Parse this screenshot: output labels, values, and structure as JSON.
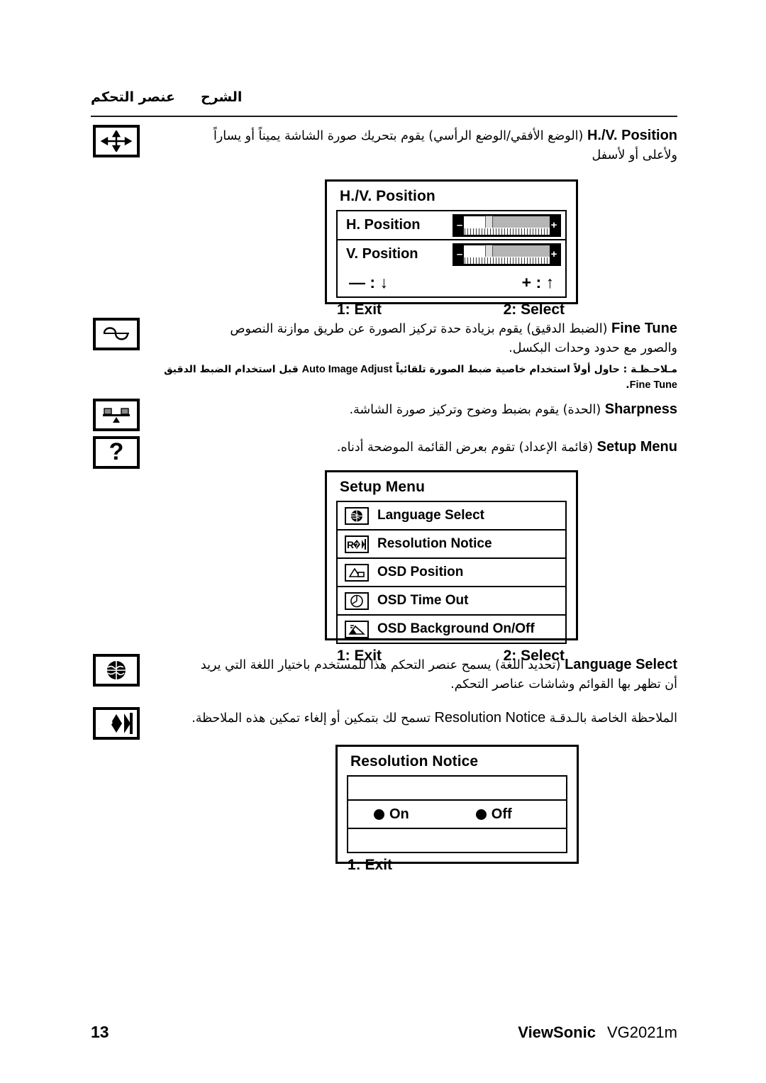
{
  "header": {
    "col_control": "عنصر التحكم",
    "col_explanation": "الشرح"
  },
  "rows": [
    {
      "icon": "four-way-arrow-icon",
      "term": "H./V. Position",
      "text_line1": "(الوضع الأفقي/الوضع الرأسي) يقوم بتحريك صورة الشاشة يميناً أو يساراً",
      "text_line2": "ولأعلى أو لأسفل"
    },
    {
      "icon": "sine-wave-icon",
      "term": "Fine Tune",
      "text_line1": "(الضبط الدقيق) يقوم بزيادة حدة تركيز الصورة عن طريق موازنة النصوص",
      "text_line2": "والصور مع حدود وحدات البكسل.",
      "note_prefix": "مـلاحـظـة : حاول أولاً استخدام خاصية ضبط الصورة تلقائياً",
      "note_term": "Auto Image Adjust",
      "note_middle": "قبل استخدام الضبط الدقيق",
      "note_term2": "Fine Tune",
      "note_suffix": "."
    },
    {
      "icon": "sharpness-balance-icon",
      "term": "Sharpness",
      "text_line1": "(الحدة) يقوم بضبط وضوح وتركيز صورة الشاشة."
    },
    {
      "icon": "question-mark-icon",
      "term": "Setup Menu",
      "text_line1": "(قائمة الإعداد) تقوم بعرض القائمة الموضحة أدناه."
    },
    {
      "icon": "globe-icon",
      "term": "Language Select",
      "text_line1": "(تحديد اللغة) يسمح عنصر التحكم هذا للمستخدم باختيار اللغة التي يريد",
      "text_line2": "أن تظهر بها القوائم وشاشات عناصر التحكم."
    },
    {
      "icon": "resolution-notice-icon",
      "term": "Resolution Notice",
      "text_before": "الملاحظة الخاصة بالـدقـة",
      "text_after": "تسمح لك بتمكين أو إلغاء تمكين هذه الملاحظة."
    }
  ],
  "osd_hv": {
    "title": "H./V. Position",
    "items": [
      {
        "label": "H. Position",
        "minus": "–",
        "plus": "+",
        "value_pct": 26
      },
      {
        "label": "V. Position",
        "minus": "–",
        "plus": "+",
        "value_pct": 26
      }
    ],
    "minus_hint": "— : ",
    "minus_arrow": "↓",
    "plus_hint": "+ : ",
    "plus_arrow": "↑",
    "exit": "1: Exit",
    "select": "2: Select"
  },
  "osd_setup": {
    "title": "Setup Menu",
    "items": [
      {
        "icon": "globe-icon",
        "label": "Language Select"
      },
      {
        "icon": "resolution-notice-icon",
        "label": "Resolution Notice"
      },
      {
        "icon": "osd-position-icon",
        "label": "OSD Position"
      },
      {
        "icon": "clock-icon",
        "label": "OSD Time Out"
      },
      {
        "icon": "osd-background-icon",
        "label": "OSD Background On/Off"
      }
    ],
    "exit": "1: Exit",
    "select": "2: Select"
  },
  "osd_resolution": {
    "title": "Resolution Notice",
    "option_on": "On",
    "option_off": "Off",
    "exit": "1: Exit"
  },
  "footer": {
    "page_number": "13",
    "brand": "ViewSonic",
    "model": "VG2021m"
  },
  "colors": {
    "ink": "#000000",
    "paper": "#ffffff",
    "track": "#b5b5b5"
  }
}
